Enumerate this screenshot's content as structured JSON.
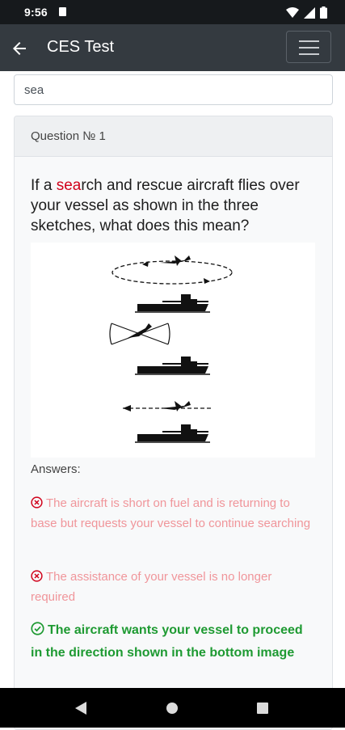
{
  "status_bar": {
    "time": "9:56"
  },
  "app_bar": {
    "title": "CES Test"
  },
  "search": {
    "value": "sea"
  },
  "question": {
    "header": "Question № 1",
    "text_highlight": "sea",
    "text_rest": "rch and rescue aircraft flies over your vessel as shown in the three sketches, what does this mean?",
    "text_prefix": "If a "
  },
  "answers": {
    "label": "Answers:",
    "items": [
      {
        "text": "The aircraft is short on fuel and is returning to base but requests your vessel to continue searching",
        "status": "wrong"
      },
      {
        "text": "The assistance of your vessel is no longer required",
        "status": "wrong"
      },
      {
        "text": "The aircraft wants your vessel to proceed in the direction shown in the bottom image",
        "status": "correct"
      }
    ]
  },
  "colors": {
    "highlight": "#d0021b",
    "wrong": "#f0959a",
    "correct": "#1e9a32",
    "app_bar": "#343a40"
  },
  "icons": [
    "back-arrow-icon",
    "hamburger-menu-icon",
    "wrong-circle-x-icon",
    "correct-circle-check-icon",
    "wifi-icon",
    "signal-icon",
    "battery-icon"
  ]
}
